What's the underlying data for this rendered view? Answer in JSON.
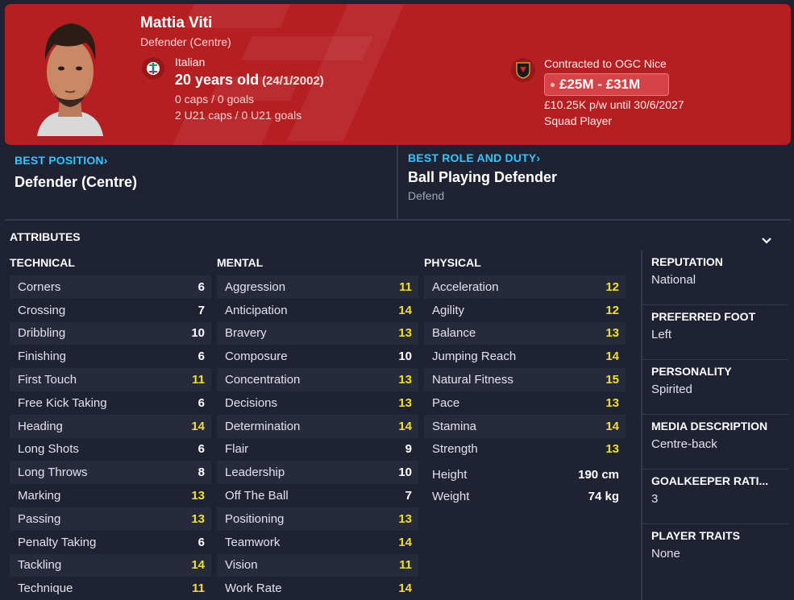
{
  "player": {
    "name": "Mattia Viti",
    "position": "Defender (Centre)",
    "nationality": "Italian",
    "age": "20 years old",
    "dob": "(24/1/2002)",
    "caps": "0 caps / 0 goals",
    "u21": "2 U21 caps / 0 U21 goals"
  },
  "contract": {
    "club_line": "Contracted to OGC Nice",
    "value": "£25M - £31M",
    "wage": "£10.25K p/w until 30/6/2027",
    "status": "Squad Player"
  },
  "best_position": {
    "label": "BEST POSITION",
    "value": "Defender (Centre)"
  },
  "best_role": {
    "label": "BEST ROLE AND DUTY",
    "value": "Ball Playing Defender",
    "duty": "Defend"
  },
  "attributes": {
    "title": "ATTRIBUTES",
    "highlight_color": "#f2e127",
    "technical": {
      "heading": "TECHNICAL",
      "rows": [
        {
          "name": "Corners",
          "value": "6"
        },
        {
          "name": "Crossing",
          "value": "7"
        },
        {
          "name": "Dribbling",
          "value": "10"
        },
        {
          "name": "Finishing",
          "value": "6"
        },
        {
          "name": "First Touch",
          "value": "11"
        },
        {
          "name": "Free Kick Taking",
          "value": "6"
        },
        {
          "name": "Heading",
          "value": "14"
        },
        {
          "name": "Long Shots",
          "value": "6"
        },
        {
          "name": "Long Throws",
          "value": "8"
        },
        {
          "name": "Marking",
          "value": "13"
        },
        {
          "name": "Passing",
          "value": "13"
        },
        {
          "name": "Penalty Taking",
          "value": "6"
        },
        {
          "name": "Tackling",
          "value": "14"
        },
        {
          "name": "Technique",
          "value": "11"
        }
      ]
    },
    "mental": {
      "heading": "MENTAL",
      "rows": [
        {
          "name": "Aggression",
          "value": "11"
        },
        {
          "name": "Anticipation",
          "value": "14"
        },
        {
          "name": "Bravery",
          "value": "13"
        },
        {
          "name": "Composure",
          "value": "10"
        },
        {
          "name": "Concentration",
          "value": "13"
        },
        {
          "name": "Decisions",
          "value": "13"
        },
        {
          "name": "Determination",
          "value": "14"
        },
        {
          "name": "Flair",
          "value": "9"
        },
        {
          "name": "Leadership",
          "value": "10"
        },
        {
          "name": "Off The Ball",
          "value": "7"
        },
        {
          "name": "Positioning",
          "value": "13"
        },
        {
          "name": "Teamwork",
          "value": "14"
        },
        {
          "name": "Vision",
          "value": "11"
        },
        {
          "name": "Work Rate",
          "value": "14"
        }
      ]
    },
    "physical": {
      "heading": "PHYSICAL",
      "rows": [
        {
          "name": "Acceleration",
          "value": "12"
        },
        {
          "name": "Agility",
          "value": "12"
        },
        {
          "name": "Balance",
          "value": "13"
        },
        {
          "name": "Jumping Reach",
          "value": "14"
        },
        {
          "name": "Natural Fitness",
          "value": "15"
        },
        {
          "name": "Pace",
          "value": "13"
        },
        {
          "name": "Stamina",
          "value": "14"
        },
        {
          "name": "Strength",
          "value": "13"
        }
      ],
      "height_label": "Height",
      "height_value": "190 cm",
      "weight_label": "Weight",
      "weight_value": "74 kg"
    }
  },
  "side": {
    "reputation_label": "REPUTATION",
    "reputation_value": "National",
    "foot_label": "PREFERRED FOOT",
    "foot_value": "Left",
    "personality_label": "PERSONALITY",
    "personality_value": "Spirited",
    "media_label": "MEDIA DESCRIPTION",
    "media_value": "Centre-back",
    "gk_label": "GOALKEEPER RATI...",
    "gk_value": "3",
    "traits_label": "PLAYER TRAITS",
    "traits_value": "None"
  }
}
